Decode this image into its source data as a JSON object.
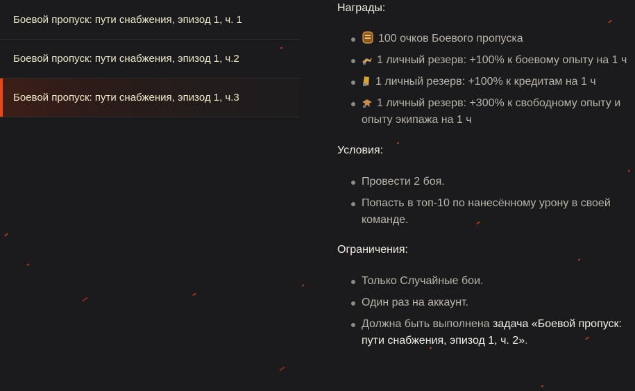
{
  "tasks": [
    {
      "label": "Боевой пропуск: пути снабжения, эпизод 1, ч. 1"
    },
    {
      "label": "Боевой пропуск: пути снабжения, эпизод 1, ч.2"
    },
    {
      "label": "Боевой пропуск: пути снабжения, эпизод 1, ч.3"
    }
  ],
  "details": {
    "rewards_title": "Награды:",
    "rewards": [
      {
        "icon": "battle-pass-points-icon",
        "text": "100 очков Боевого пропуска"
      },
      {
        "icon": "combat-xp-reserve-icon",
        "text": "1 личный резерв: +100% к боевому опыту на 1 ч"
      },
      {
        "icon": "credits-reserve-icon",
        "text": "1 личный резерв: +100% к кредитам на 1 ч"
      },
      {
        "icon": "free-xp-reserve-icon",
        "text": "1 личный резерв: +300% к свободному опыту и опыту экипажа на 1 ч"
      }
    ],
    "conditions_title": "Условия:",
    "conditions": [
      "Провести 2 боя.",
      "Попасть в топ-10 по нанесённому урону в своей команде."
    ],
    "restrictions_title": "Ограничения:",
    "restrictions": [
      "Только Случайные бои.",
      "Один раз на аккаунт."
    ],
    "restriction_last": {
      "prefix": "Должна быть выполнена ",
      "highlight": "задача «Боевой пропуск: пути снабжения, эпизод 1, ч. 2»",
      "suffix": "."
    }
  },
  "colors": {
    "background": "#1b1a1c",
    "accent": "#e24a1c",
    "title_text": "#efe7c8"
  }
}
